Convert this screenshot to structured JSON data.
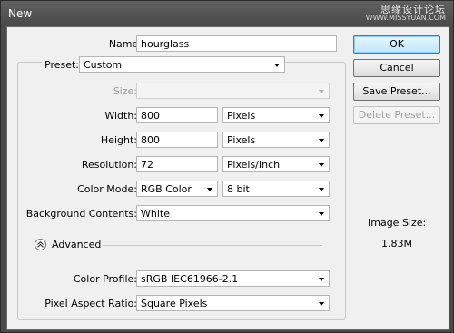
{
  "window": {
    "title": "New",
    "watermark_line1": "思缘设计论坛",
    "watermark_line2": "WWW.MISSYUAN.COM"
  },
  "form": {
    "name": {
      "label": "Name:",
      "value": "hourglass"
    },
    "preset": {
      "label": "Preset:",
      "value": "Custom"
    },
    "size": {
      "label": "Size:",
      "value": ""
    },
    "width": {
      "label": "Width:",
      "value": "800",
      "unit": "Pixels"
    },
    "height": {
      "label": "Height:",
      "value": "800",
      "unit": "Pixels"
    },
    "resolution": {
      "label": "Resolution:",
      "value": "72",
      "unit": "Pixels/Inch"
    },
    "color_mode": {
      "label": "Color Mode:",
      "mode": "RGB Color",
      "depth": "8 bit"
    },
    "background": {
      "label": "Background Contents:",
      "value": "White"
    },
    "advanced": {
      "label": "Advanced"
    },
    "color_profile": {
      "label": "Color Profile:",
      "value": "sRGB IEC61966-2.1"
    },
    "pixel_aspect": {
      "label": "Pixel Aspect Ratio:",
      "value": "Square Pixels"
    }
  },
  "buttons": {
    "ok": "OK",
    "cancel": "Cancel",
    "save_preset": "Save Preset...",
    "delete_preset": "Delete Preset..."
  },
  "image_size": {
    "label": "Image Size:",
    "value": "1.83M"
  },
  "icons": {
    "advanced_toggle": "chevron-up-circle-icon",
    "dropdown": "chevron-down-icon"
  }
}
